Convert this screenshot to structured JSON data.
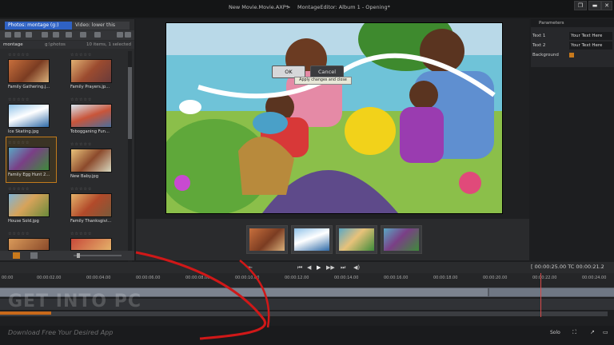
{
  "window": {
    "title_left": "New Movie.Movie.AXP*",
    "title_sep": ">",
    "title_right": "MontageEditor: Album 1 - Opening*"
  },
  "library": {
    "tabs": [
      "Photos: montage (g:)",
      "Video: lower this"
    ],
    "folder": "montage",
    "path": "g:\\photos",
    "count": "10 items, 1 selected",
    "items": [
      {
        "label": "Family Gathering.j...",
        "selected": false
      },
      {
        "label": "Family Prayers.jp...",
        "selected": false
      },
      {
        "label": "Ice Skating.jpg",
        "selected": false
      },
      {
        "label": "Tobogganing Fun...",
        "selected": false
      },
      {
        "label": "Family Egg Hunt 2...",
        "selected": true
      },
      {
        "label": "New Baby.jpg",
        "selected": false
      },
      {
        "label": "House Sold.jpg",
        "selected": false
      },
      {
        "label": "Family Thanksgivi...",
        "selected": false
      }
    ]
  },
  "parameters": {
    "header": "Parameters",
    "rows": [
      {
        "label": "Text 1",
        "value": "Your Text Here"
      },
      {
        "label": "Text 2",
        "value": "Your Text Here"
      },
      {
        "label": "Background",
        "value": ""
      }
    ]
  },
  "timeline": {
    "timecode": "[ 00:00:25.00   TC  00:00:21.2",
    "ticks": [
      "00:00",
      "00:00:02.00",
      "00:00:04.00",
      "00:00:06.00",
      "00:00:08.00",
      "00:00:10.00",
      "00:00:12.00",
      "00:00:14.00",
      "00:00:16.00",
      "00:00:18.00",
      "00:00:20.00",
      "00:00:22.00",
      "00:00:24.00"
    ],
    "solo": "Solo"
  },
  "buttons": {
    "ok": "OK",
    "cancel": "Cancel",
    "tooltip": "Apply changes and close"
  },
  "watermark": {
    "logo": "GET INTO PC",
    "tagline": "Download Free Your Desired App"
  },
  "colors": {
    "accent": "#2f62c4",
    "selection": "#c27b1c",
    "annotation": "#d01818"
  }
}
